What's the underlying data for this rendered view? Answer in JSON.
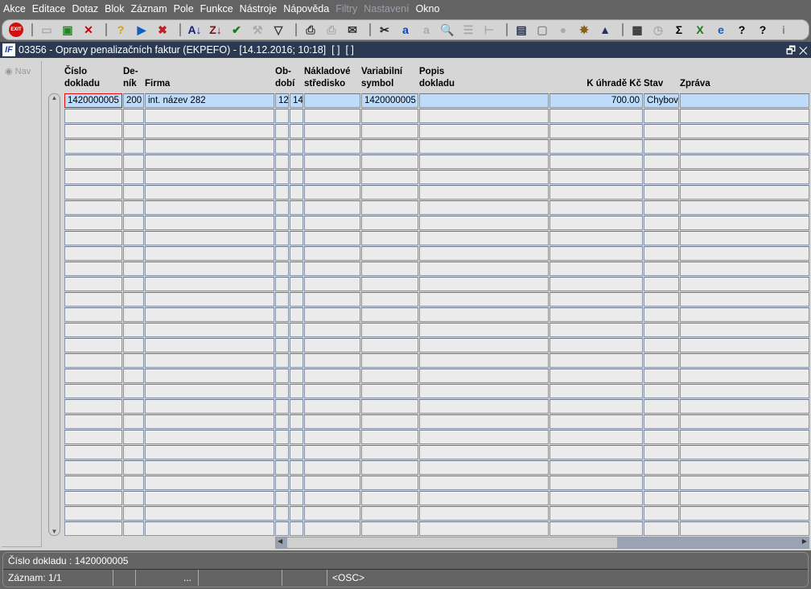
{
  "menu": [
    "Akce",
    "Editace",
    "Dotaz",
    "Blok",
    "Záznam",
    "Pole",
    "Funkce",
    "Nástroje",
    "Nápověda",
    "Filtry",
    "Nastavení",
    "Okno"
  ],
  "menu_disabled": [
    "Filtry",
    "Nastavení"
  ],
  "toolbar": [
    {
      "name": "exit",
      "glyph": "EXIT",
      "color": "#d01010"
    },
    {
      "name": "sep"
    },
    {
      "name": "insert-record",
      "glyph": "▭",
      "color": "#aaa"
    },
    {
      "name": "duplicate-record",
      "glyph": "▣",
      "color": "#1a8a1a"
    },
    {
      "name": "delete-record",
      "glyph": "✕",
      "color": "#c00"
    },
    {
      "name": "sep"
    },
    {
      "name": "query",
      "glyph": "?",
      "color": "#d4a000"
    },
    {
      "name": "execute-query",
      "glyph": "▶",
      "color": "#1060c0"
    },
    {
      "name": "cancel-query",
      "glyph": "✖",
      "color": "#c02020"
    },
    {
      "name": "sep"
    },
    {
      "name": "sort-asc",
      "glyph": "A↓",
      "color": "#102080"
    },
    {
      "name": "sort-desc",
      "glyph": "Z↓",
      "color": "#801010"
    },
    {
      "name": "commit",
      "glyph": "✔",
      "color": "#108010"
    },
    {
      "name": "tools",
      "glyph": "⚒",
      "color": "#aaa"
    },
    {
      "name": "filter",
      "glyph": "▽",
      "color": "#333"
    },
    {
      "name": "sep"
    },
    {
      "name": "print",
      "glyph": "⎙",
      "color": "#333"
    },
    {
      "name": "print-multi",
      "glyph": "⎙",
      "color": "#aaa"
    },
    {
      "name": "mail",
      "glyph": "✉",
      "color": "#333"
    },
    {
      "name": "sep"
    },
    {
      "name": "cut",
      "glyph": "✂",
      "color": "#222"
    },
    {
      "name": "copy",
      "glyph": "a",
      "color": "#1040c0"
    },
    {
      "name": "paste",
      "glyph": "a",
      "color": "#aaa"
    },
    {
      "name": "find",
      "glyph": "🔍",
      "color": "#1060c0"
    },
    {
      "name": "list",
      "glyph": "☰",
      "color": "#aaa"
    },
    {
      "name": "tree",
      "glyph": "⊢",
      "color": "#aaa"
    },
    {
      "name": "sep"
    },
    {
      "name": "export",
      "glyph": "▤",
      "color": "#203060"
    },
    {
      "name": "document",
      "glyph": "▢",
      "color": "#888"
    },
    {
      "name": "globe",
      "glyph": "●",
      "color": "#aaa"
    },
    {
      "name": "helm",
      "glyph": "✵",
      "color": "#8a5a10"
    },
    {
      "name": "eye",
      "glyph": "▲",
      "color": "#203060"
    },
    {
      "name": "sep"
    },
    {
      "name": "chart",
      "glyph": "▦",
      "color": "#333"
    },
    {
      "name": "clock",
      "glyph": "◷",
      "color": "#aaa"
    },
    {
      "name": "sum",
      "glyph": "Σ",
      "color": "#000"
    },
    {
      "name": "excel",
      "glyph": "X",
      "color": "#1a7a1a"
    },
    {
      "name": "browser",
      "glyph": "e",
      "color": "#1060c0"
    },
    {
      "name": "help-context",
      "glyph": "?",
      "color": "#000"
    },
    {
      "name": "help",
      "glyph": "?",
      "color": "#000"
    },
    {
      "name": "info",
      "glyph": "i",
      "color": "#888"
    }
  ],
  "window": {
    "logo": "IF",
    "title": "03356 - Opravy penalizačních faktur (EKPEFO) - [14.12.2016; 10:18]  [ ]  [ ]",
    "restore": "🗗",
    "close": "✕"
  },
  "nav": {
    "label": "Nav"
  },
  "columns": [
    {
      "l1": "Číslo",
      "l2": "dokladu"
    },
    {
      "l1": "De-",
      "l2": "ník"
    },
    {
      "l1": "",
      "l2": "Firma"
    },
    {
      "l1": "Ob-",
      "l2": "dobí"
    },
    {
      "l1": "",
      "l2": ""
    },
    {
      "l1": "Nákladové",
      "l2": "středisko"
    },
    {
      "l1": "Variabilní",
      "l2": "symbol"
    },
    {
      "l1": "Popis",
      "l2": "dokladu"
    },
    {
      "l1": "",
      "l2": "K úhradě Kč"
    },
    {
      "l1": "",
      "l2": "Stav"
    },
    {
      "l1": "",
      "l2": "Zpráva"
    }
  ],
  "rows": [
    [
      "1420000005",
      "200",
      "int. název 282",
      "12",
      "14",
      "",
      "1420000005",
      "",
      "700.00",
      "Chybový",
      ""
    ]
  ],
  "empty_rows": 28,
  "status": {
    "line1": "Číslo dokladu : 1420000005",
    "record": "Záznam: 1/1",
    "ellipsis": "...",
    "mode": "<OSC>"
  }
}
